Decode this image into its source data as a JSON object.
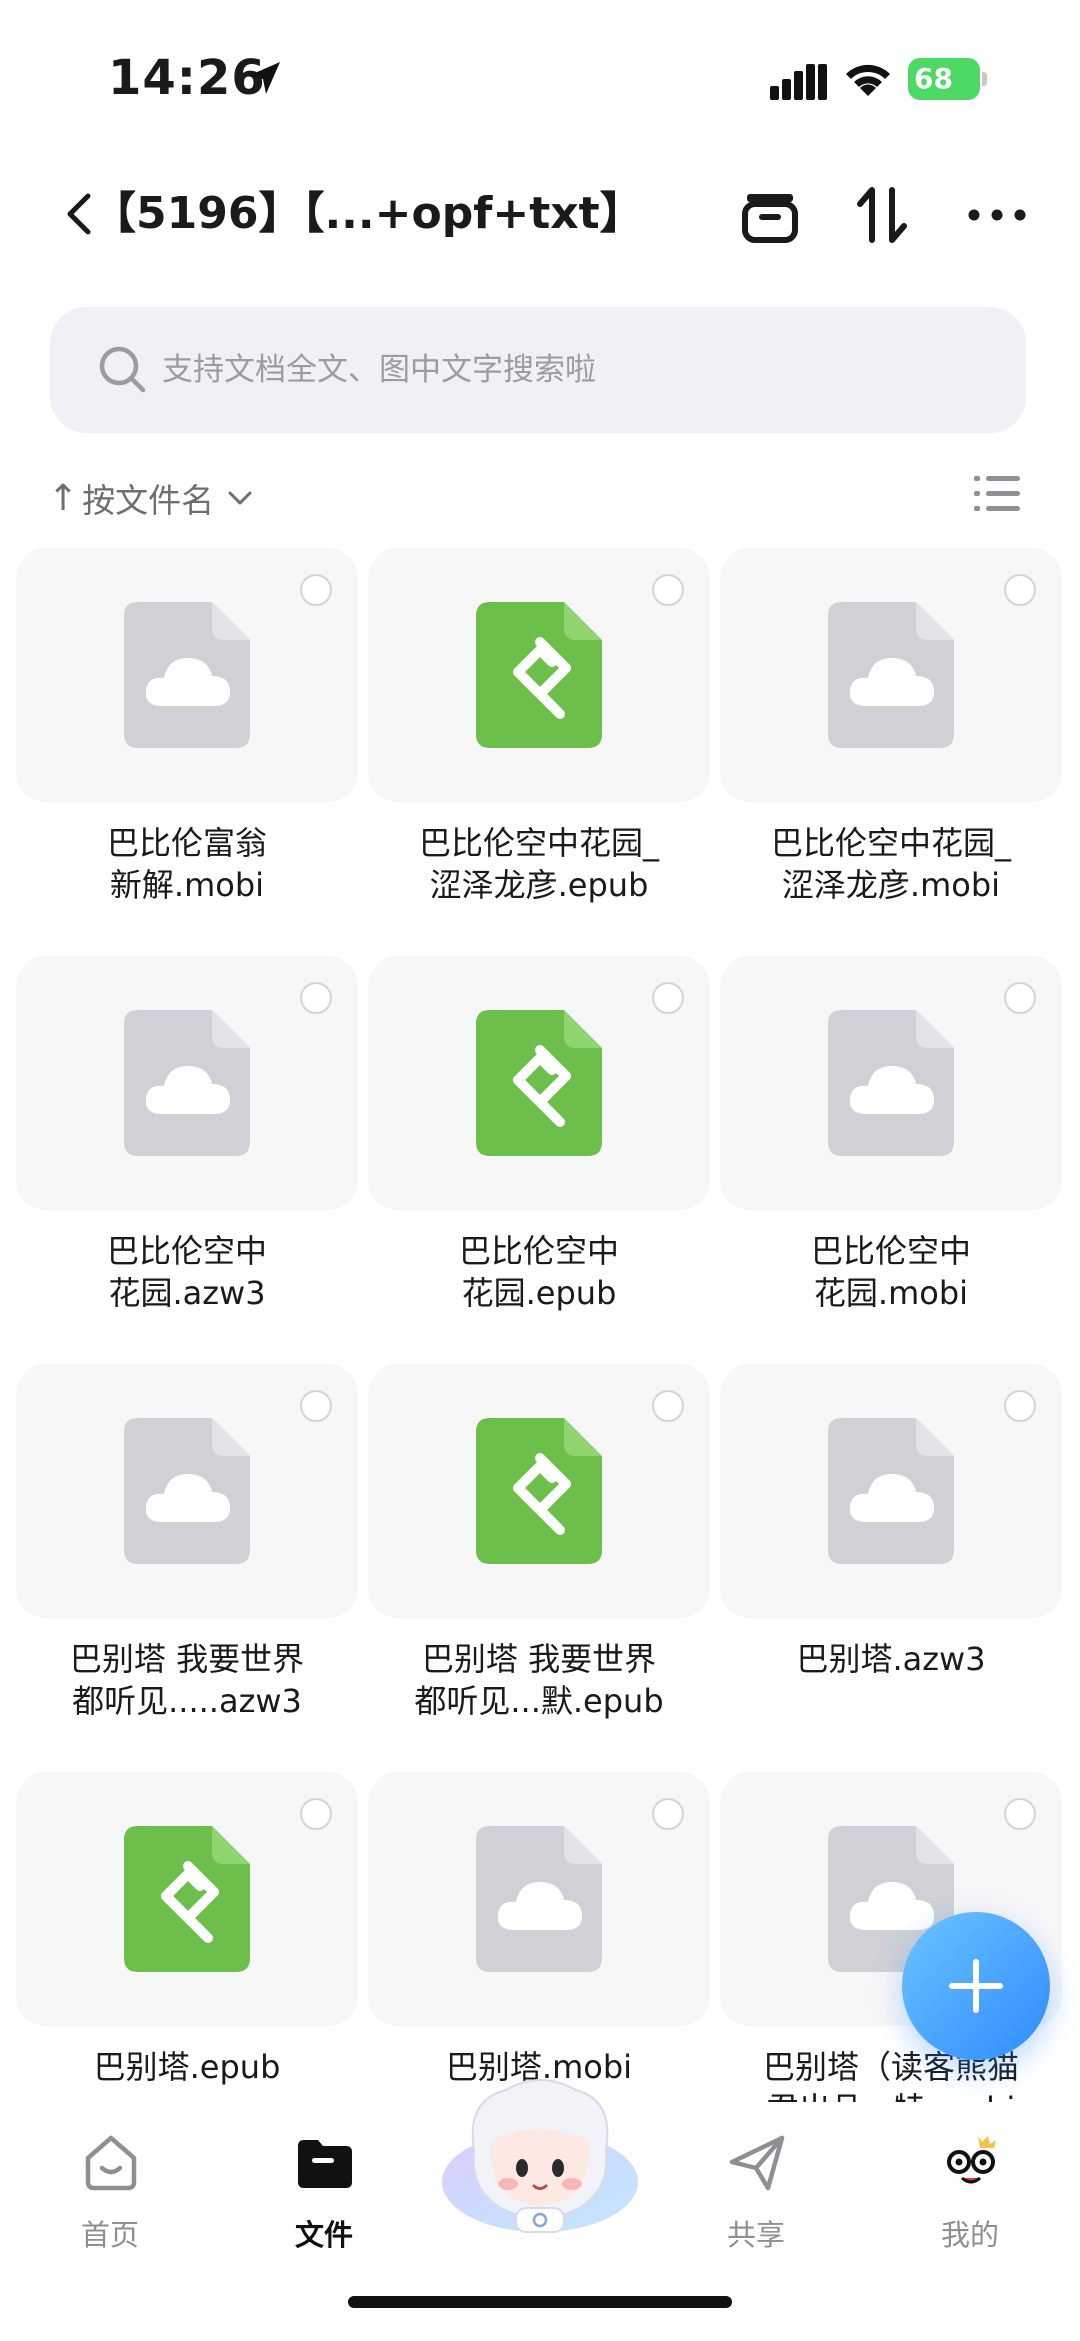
{
  "status_bar": {
    "time": "14:26",
    "battery_level": "68"
  },
  "header": {
    "title": "【5196】【...+opf+txt】"
  },
  "search": {
    "placeholder": "支持文档全文、图中文字搜索啦"
  },
  "sort": {
    "label": "按文件名"
  },
  "files": [
    {
      "line1": "巴比伦富翁",
      "line2": "新解.mobi",
      "type": "cloud"
    },
    {
      "line1": "巴比伦空中花园_",
      "line2": "涩泽龙彦.epub",
      "type": "epub"
    },
    {
      "line1": "巴比伦空中花园_",
      "line2": "涩泽龙彦.mobi",
      "type": "cloud"
    },
    {
      "line1": "巴比伦空中",
      "line2": "花园.azw3",
      "type": "cloud"
    },
    {
      "line1": "巴比伦空中",
      "line2": "花园.epub",
      "type": "epub"
    },
    {
      "line1": "巴比伦空中",
      "line2": "花园.mobi",
      "type": "cloud"
    },
    {
      "line1": "巴别塔  我要世界",
      "line2": "都听见.....azw3",
      "type": "cloud"
    },
    {
      "line1": "巴别塔  我要世界",
      "line2": "都听见...默.epub",
      "type": "epub"
    },
    {
      "line1": "巴别塔.azw3",
      "line2": "",
      "type": "cloud"
    },
    {
      "line1": "巴别塔.epub",
      "line2": "",
      "type": "epub"
    },
    {
      "line1": "巴别塔.mobi",
      "line2": "",
      "type": "cloud"
    },
    {
      "line1": "巴别塔（读客熊猫",
      "line2": "君出品...特.mobi",
      "type": "cloud"
    }
  ],
  "tabbar": {
    "items": [
      {
        "label": "首页",
        "icon": "home-icon"
      },
      {
        "label": "文件",
        "icon": "folder-icon"
      },
      {
        "label": "共享",
        "icon": "share-icon"
      },
      {
        "label": "我的",
        "icon": "profile-icon"
      }
    ],
    "active": "文件"
  },
  "colors": {
    "epub_green": "#6cbf4b",
    "cloud_gray": "#cfd1d6",
    "fab_blue": "#2f8bff",
    "battery_green": "#4cd964"
  }
}
